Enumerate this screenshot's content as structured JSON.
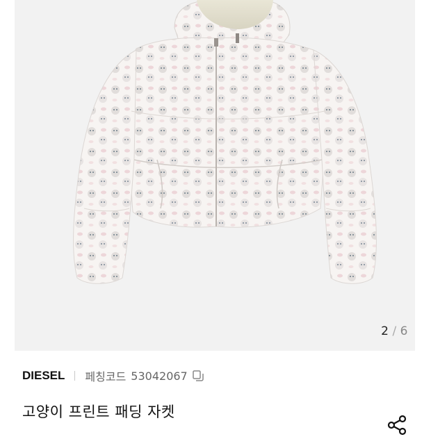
{
  "gallery": {
    "current": "2",
    "separator": "/",
    "total": "6",
    "image_alt": "jacket-photo"
  },
  "product": {
    "brand": "DIESEL",
    "code_label": "페칭코드",
    "code_value": "53042067",
    "title": "고양이 프린트 패딩 자켓"
  },
  "icons": {
    "copy": "copy-icon",
    "share": "share-icon"
  },
  "colors": {
    "gallery_bg": "#f2f2f2",
    "text_primary": "#111111",
    "text_secondary": "#666666"
  }
}
